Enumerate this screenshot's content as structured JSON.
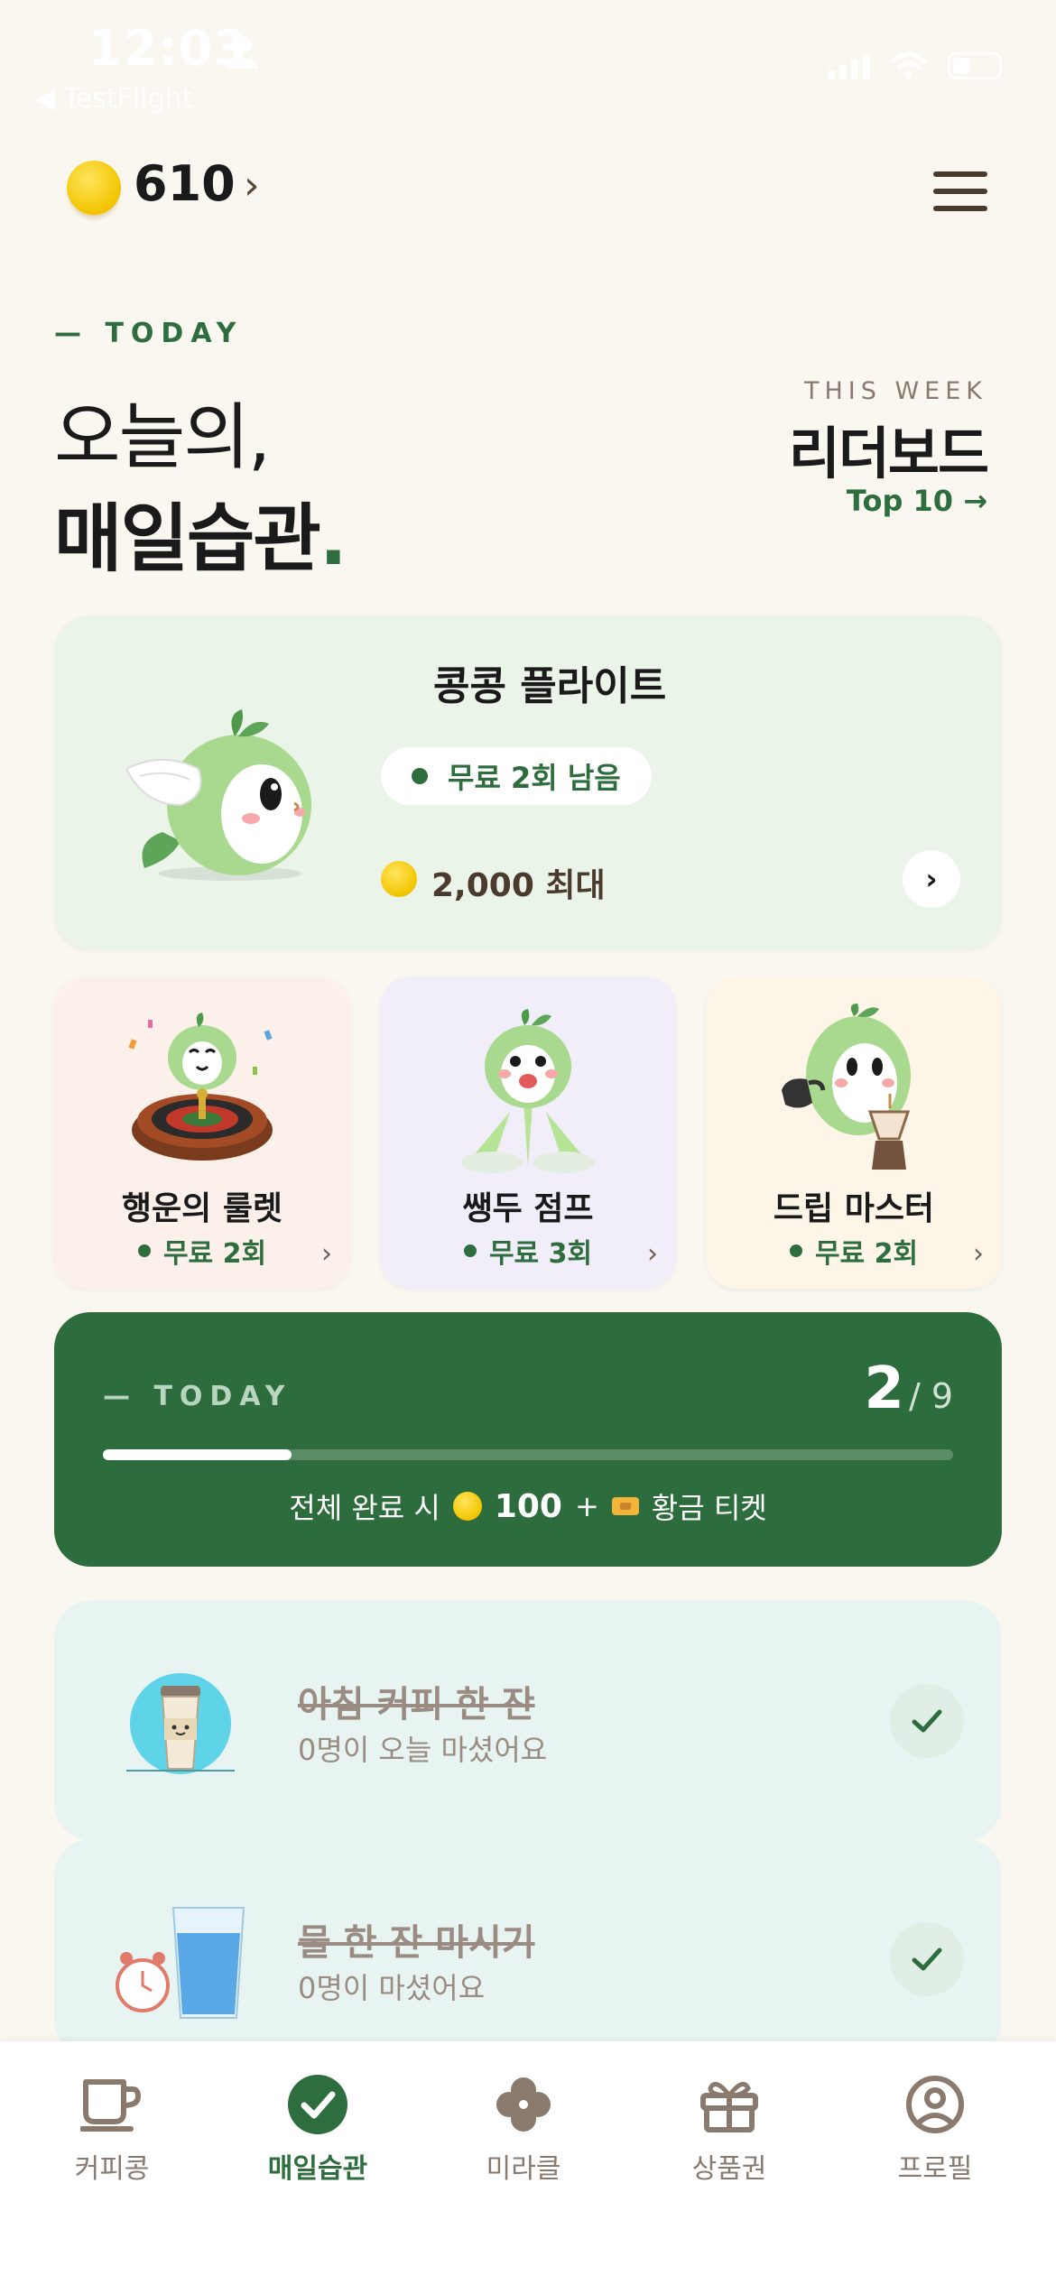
{
  "status_bar": {
    "time": "12:03",
    "back_app": "◀ TestFlight"
  },
  "header": {
    "coin_balance": "610",
    "chevron": "›"
  },
  "today": {
    "tag": "— TODAY",
    "title_line1": "오늘의,",
    "title_line2": "매일습관",
    "title_dot": "."
  },
  "leaderboard": {
    "tag": "THIS WEEK",
    "title": "리더보드",
    "link": "Top 10 →"
  },
  "feature_game": {
    "title": "콩콩 플라이트",
    "pill": "무료 2회 남음",
    "max_reward": "2,000 최대",
    "go": "›"
  },
  "mini_games": [
    {
      "title": "행운의 룰렛",
      "sub": "무료 2회",
      "chevron": "›",
      "bg": "#FBF0EA"
    },
    {
      "title": "쌩두 점프",
      "sub": "무료 3회",
      "chevron": "›",
      "bg": "#F1EEFA"
    },
    {
      "title": "드립 마스터",
      "sub": "무료 2회",
      "chevron": "›",
      "bg": "#FCF5E8"
    }
  ],
  "progress": {
    "tag": "— TODAY",
    "done": "2",
    "total": "/ 9",
    "fraction": 0.222,
    "reward_prefix": "전체 완료 시",
    "reward_coins": "100",
    "plus": "+",
    "reward_ticket": "황금 티켓"
  },
  "habits": [
    {
      "title": "아침 커피 한 잔",
      "sub": "0명이 오늘 마셨어요",
      "done": true
    },
    {
      "title": "물 한 잔 마시기",
      "sub": "0명이 마셨어요",
      "done": true
    }
  ],
  "tabs": [
    {
      "label": "커피콩",
      "icon": "coffee-cup-icon",
      "active": false
    },
    {
      "label": "매일습관",
      "icon": "check-circle-icon",
      "active": true
    },
    {
      "label": "미라클",
      "icon": "clover-icon",
      "active": false
    },
    {
      "label": "상품권",
      "icon": "gift-icon",
      "active": false
    },
    {
      "label": "프로필",
      "icon": "user-circle-icon",
      "active": false
    }
  ],
  "colors": {
    "accent": "#2E6E3E",
    "background": "#FAF7F1",
    "feature_bg": "#EAF4E8",
    "habit_bg": "#E7F4F1",
    "brown": "#4B3A2E"
  }
}
